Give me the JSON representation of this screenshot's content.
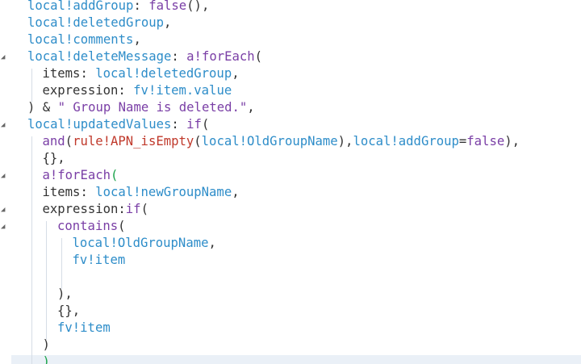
{
  "editor": {
    "lines": [
      {
        "indent": 0,
        "tokens": [
          {
            "c": "var",
            "t": "local!addGroup"
          },
          {
            "c": "op",
            "t": ": "
          },
          {
            "c": "fn",
            "t": "false"
          },
          {
            "c": "op",
            "t": "(),"
          }
        ]
      },
      {
        "indent": 0,
        "tokens": [
          {
            "c": "var",
            "t": "local!deletedGroup"
          },
          {
            "c": "op",
            "t": ","
          }
        ]
      },
      {
        "indent": 0,
        "tokens": [
          {
            "c": "var",
            "t": "local!comments"
          },
          {
            "c": "op",
            "t": ","
          }
        ]
      },
      {
        "indent": 0,
        "tokens": [
          {
            "c": "var",
            "t": "local!deleteMessage"
          },
          {
            "c": "op",
            "t": ": "
          },
          {
            "c": "fn",
            "t": "a!forEach"
          },
          {
            "c": "op",
            "t": "("
          }
        ]
      },
      {
        "indent": 1,
        "tokens": [
          {
            "c": "op",
            "t": "items: "
          },
          {
            "c": "var",
            "t": "local!deletedGroup"
          },
          {
            "c": "op",
            "t": ","
          }
        ]
      },
      {
        "indent": 1,
        "tokens": [
          {
            "c": "op",
            "t": "expression: "
          },
          {
            "c": "var",
            "t": "fv!item.value"
          }
        ]
      },
      {
        "indent": 0,
        "tokens": [
          {
            "c": "op",
            "t": ") & "
          },
          {
            "c": "str",
            "t": "\" Group Name is deleted.\""
          },
          {
            "c": "op",
            "t": ","
          }
        ]
      },
      {
        "indent": 0,
        "tokens": [
          {
            "c": "var",
            "t": "local!updatedValues"
          },
          {
            "c": "op",
            "t": ": "
          },
          {
            "c": "fn",
            "t": "if"
          },
          {
            "c": "op",
            "t": "("
          }
        ]
      },
      {
        "indent": 1,
        "tokens": [
          {
            "c": "fn",
            "t": "and"
          },
          {
            "c": "op",
            "t": "("
          },
          {
            "c": "rule",
            "t": "rule!APN_isEmpty"
          },
          {
            "c": "op",
            "t": "("
          },
          {
            "c": "var",
            "t": "local!OldGroupName"
          },
          {
            "c": "op",
            "t": "),"
          },
          {
            "c": "var",
            "t": "local!addGroup"
          },
          {
            "c": "op",
            "t": "="
          },
          {
            "c": "fn",
            "t": "false"
          },
          {
            "c": "op",
            "t": "),"
          }
        ]
      },
      {
        "indent": 1,
        "tokens": [
          {
            "c": "op",
            "t": "{},"
          }
        ]
      },
      {
        "indent": 1,
        "tokens": [
          {
            "c": "fn",
            "t": "a!forEach"
          },
          {
            "c": "green",
            "t": "("
          }
        ]
      },
      {
        "indent": 1,
        "tokens": [
          {
            "c": "op",
            "t": "items: "
          },
          {
            "c": "var",
            "t": "local!newGroupName"
          },
          {
            "c": "op",
            "t": ","
          }
        ]
      },
      {
        "indent": 1,
        "tokens": [
          {
            "c": "op",
            "t": "expression:"
          },
          {
            "c": "fn",
            "t": "if"
          },
          {
            "c": "op",
            "t": "("
          }
        ]
      },
      {
        "indent": 2,
        "tokens": [
          {
            "c": "fn",
            "t": "contains"
          },
          {
            "c": "op",
            "t": "("
          }
        ]
      },
      {
        "indent": 3,
        "tokens": [
          {
            "c": "var",
            "t": "local!OldGroupName"
          },
          {
            "c": "op",
            "t": ","
          }
        ]
      },
      {
        "indent": 3,
        "tokens": [
          {
            "c": "var",
            "t": "fv!item"
          }
        ]
      },
      {
        "indent": 3,
        "tokens": []
      },
      {
        "indent": 2,
        "tokens": [
          {
            "c": "op",
            "t": "),"
          }
        ]
      },
      {
        "indent": 2,
        "tokens": [
          {
            "c": "op",
            "t": "{},"
          }
        ]
      },
      {
        "indent": 2,
        "tokens": [
          {
            "c": "var",
            "t": "fv!item"
          }
        ]
      },
      {
        "indent": 1,
        "tokens": [
          {
            "c": "op",
            "t": ")"
          }
        ]
      },
      {
        "indent": 1,
        "tokens": [
          {
            "c": "green",
            "t": ")"
          }
        ]
      }
    ],
    "fold_lines": [
      3,
      7,
      10,
      12,
      13
    ]
  }
}
